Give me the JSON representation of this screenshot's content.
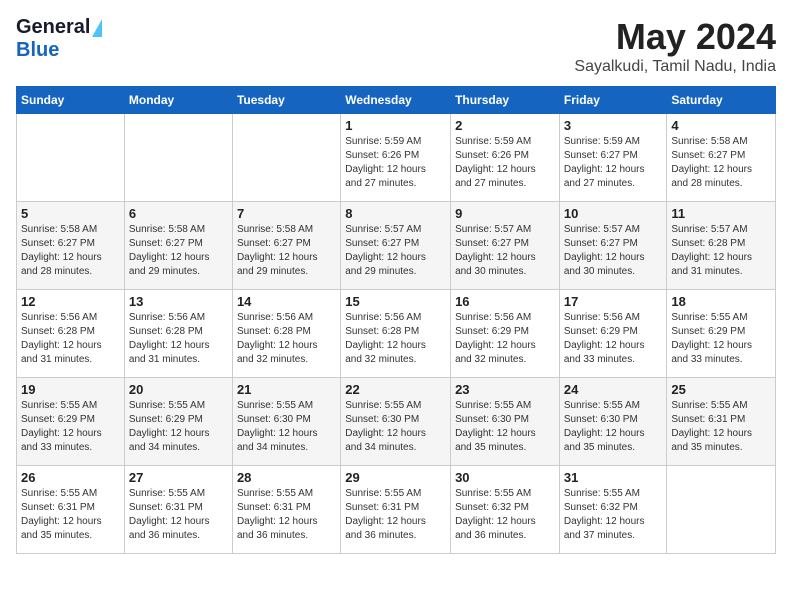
{
  "logo": {
    "line1": "General",
    "line2": "Blue"
  },
  "title": "May 2024",
  "location": "Sayalkudi, Tamil Nadu, India",
  "days_header": [
    "Sunday",
    "Monday",
    "Tuesday",
    "Wednesday",
    "Thursday",
    "Friday",
    "Saturday"
  ],
  "weeks": [
    [
      {
        "day": "",
        "info": ""
      },
      {
        "day": "",
        "info": ""
      },
      {
        "day": "",
        "info": ""
      },
      {
        "day": "1",
        "info": "Sunrise: 5:59 AM\nSunset: 6:26 PM\nDaylight: 12 hours\nand 27 minutes."
      },
      {
        "day": "2",
        "info": "Sunrise: 5:59 AM\nSunset: 6:26 PM\nDaylight: 12 hours\nand 27 minutes."
      },
      {
        "day": "3",
        "info": "Sunrise: 5:59 AM\nSunset: 6:27 PM\nDaylight: 12 hours\nand 27 minutes."
      },
      {
        "day": "4",
        "info": "Sunrise: 5:58 AM\nSunset: 6:27 PM\nDaylight: 12 hours\nand 28 minutes."
      }
    ],
    [
      {
        "day": "5",
        "info": "Sunrise: 5:58 AM\nSunset: 6:27 PM\nDaylight: 12 hours\nand 28 minutes."
      },
      {
        "day": "6",
        "info": "Sunrise: 5:58 AM\nSunset: 6:27 PM\nDaylight: 12 hours\nand 29 minutes."
      },
      {
        "day": "7",
        "info": "Sunrise: 5:58 AM\nSunset: 6:27 PM\nDaylight: 12 hours\nand 29 minutes."
      },
      {
        "day": "8",
        "info": "Sunrise: 5:57 AM\nSunset: 6:27 PM\nDaylight: 12 hours\nand 29 minutes."
      },
      {
        "day": "9",
        "info": "Sunrise: 5:57 AM\nSunset: 6:27 PM\nDaylight: 12 hours\nand 30 minutes."
      },
      {
        "day": "10",
        "info": "Sunrise: 5:57 AM\nSunset: 6:27 PM\nDaylight: 12 hours\nand 30 minutes."
      },
      {
        "day": "11",
        "info": "Sunrise: 5:57 AM\nSunset: 6:28 PM\nDaylight: 12 hours\nand 31 minutes."
      }
    ],
    [
      {
        "day": "12",
        "info": "Sunrise: 5:56 AM\nSunset: 6:28 PM\nDaylight: 12 hours\nand 31 minutes."
      },
      {
        "day": "13",
        "info": "Sunrise: 5:56 AM\nSunset: 6:28 PM\nDaylight: 12 hours\nand 31 minutes."
      },
      {
        "day": "14",
        "info": "Sunrise: 5:56 AM\nSunset: 6:28 PM\nDaylight: 12 hours\nand 32 minutes."
      },
      {
        "day": "15",
        "info": "Sunrise: 5:56 AM\nSunset: 6:28 PM\nDaylight: 12 hours\nand 32 minutes."
      },
      {
        "day": "16",
        "info": "Sunrise: 5:56 AM\nSunset: 6:29 PM\nDaylight: 12 hours\nand 32 minutes."
      },
      {
        "day": "17",
        "info": "Sunrise: 5:56 AM\nSunset: 6:29 PM\nDaylight: 12 hours\nand 33 minutes."
      },
      {
        "day": "18",
        "info": "Sunrise: 5:55 AM\nSunset: 6:29 PM\nDaylight: 12 hours\nand 33 minutes."
      }
    ],
    [
      {
        "day": "19",
        "info": "Sunrise: 5:55 AM\nSunset: 6:29 PM\nDaylight: 12 hours\nand 33 minutes."
      },
      {
        "day": "20",
        "info": "Sunrise: 5:55 AM\nSunset: 6:29 PM\nDaylight: 12 hours\nand 34 minutes."
      },
      {
        "day": "21",
        "info": "Sunrise: 5:55 AM\nSunset: 6:30 PM\nDaylight: 12 hours\nand 34 minutes."
      },
      {
        "day": "22",
        "info": "Sunrise: 5:55 AM\nSunset: 6:30 PM\nDaylight: 12 hours\nand 34 minutes."
      },
      {
        "day": "23",
        "info": "Sunrise: 5:55 AM\nSunset: 6:30 PM\nDaylight: 12 hours\nand 35 minutes."
      },
      {
        "day": "24",
        "info": "Sunrise: 5:55 AM\nSunset: 6:30 PM\nDaylight: 12 hours\nand 35 minutes."
      },
      {
        "day": "25",
        "info": "Sunrise: 5:55 AM\nSunset: 6:31 PM\nDaylight: 12 hours\nand 35 minutes."
      }
    ],
    [
      {
        "day": "26",
        "info": "Sunrise: 5:55 AM\nSunset: 6:31 PM\nDaylight: 12 hours\nand 35 minutes."
      },
      {
        "day": "27",
        "info": "Sunrise: 5:55 AM\nSunset: 6:31 PM\nDaylight: 12 hours\nand 36 minutes."
      },
      {
        "day": "28",
        "info": "Sunrise: 5:55 AM\nSunset: 6:31 PM\nDaylight: 12 hours\nand 36 minutes."
      },
      {
        "day": "29",
        "info": "Sunrise: 5:55 AM\nSunset: 6:31 PM\nDaylight: 12 hours\nand 36 minutes."
      },
      {
        "day": "30",
        "info": "Sunrise: 5:55 AM\nSunset: 6:32 PM\nDaylight: 12 hours\nand 36 minutes."
      },
      {
        "day": "31",
        "info": "Sunrise: 5:55 AM\nSunset: 6:32 PM\nDaylight: 12 hours\nand 37 minutes."
      },
      {
        "day": "",
        "info": ""
      }
    ]
  ]
}
